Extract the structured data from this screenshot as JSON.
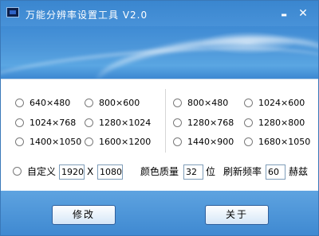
{
  "window": {
    "title": "万能分辨率设置工具 V2.0",
    "minimize_glyph": "▬",
    "close_glyph": "✕"
  },
  "resolutions_left": [
    {
      "label": "640×480"
    },
    {
      "label": "800×600"
    },
    {
      "label": "1024×768"
    },
    {
      "label": "1280×1024"
    },
    {
      "label": "1400×1050"
    },
    {
      "label": "1600×1200"
    }
  ],
  "resolutions_right": [
    {
      "label": "800×480"
    },
    {
      "label": "1024×600"
    },
    {
      "label": "1280×768"
    },
    {
      "label": "1280×800"
    },
    {
      "label": "1440×900"
    },
    {
      "label": "1680×1050"
    }
  ],
  "custom": {
    "label": "自定义",
    "width": "1920",
    "times": "X",
    "height": "1080",
    "color_depth_label": "颜色质量",
    "color_depth_value": "32",
    "color_depth_unit": "位",
    "refresh_label": "刷新频率",
    "refresh_value": "60",
    "refresh_unit": "赫兹"
  },
  "buttons": {
    "modify": "修改",
    "about": "关于"
  },
  "colors": {
    "titlebar": "#3a86cf",
    "accent": "#4d95d6"
  }
}
